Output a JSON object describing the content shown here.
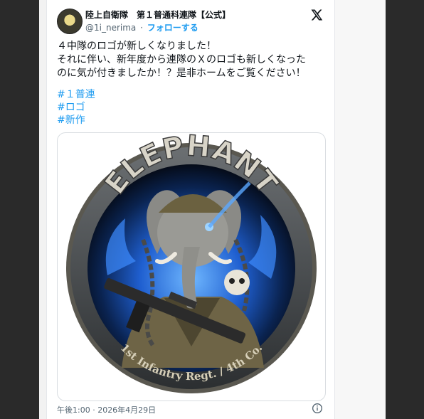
{
  "account": {
    "display_name": "陸上自衛隊　第１普通科連隊【公式】",
    "handle": "@1i_nerima",
    "separator": "·",
    "follow_label": "フォローする"
  },
  "tweet": {
    "lines": [
      "４中隊のロゴが新しくなりました！",
      "それに伴い、新年度から連隊のＸのロゴも新しくなった",
      "のに気が付きましたか！？是非ホームをご覧ください！"
    ],
    "hashtags": [
      "#１普連",
      "#ロゴ",
      "#新作"
    ]
  },
  "media": {
    "logo_top_text": "ELEPHANT",
    "logo_bottom_text": "1st Infantry Regt. / 4th Co."
  },
  "timestamp": "午後1:00 · 2026年4月29日",
  "icons": {
    "platform": "x-logo-icon",
    "info": "info-icon",
    "avatar": "unit-emblem-avatar"
  },
  "colors": {
    "link": "#1d9bf0",
    "text": "#0f1419",
    "muted": "#536471",
    "glow": "#2d7bff"
  }
}
